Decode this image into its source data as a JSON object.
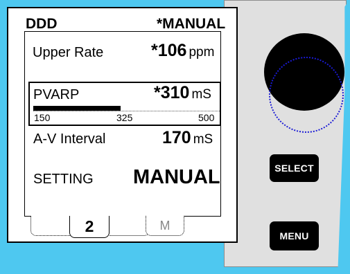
{
  "header": {
    "mode": "DDD",
    "status": "*MANUAL"
  },
  "upper_rate": {
    "label": "Upper Rate",
    "value": "*106",
    "unit": "ppm"
  },
  "pvarp": {
    "label": "PVARP",
    "value": "*310",
    "unit": "mS",
    "scale": {
      "min_label": "150",
      "mid_label": "325",
      "max_label": "500"
    },
    "slider_fraction": 0.47
  },
  "av_interval": {
    "label": "A-V Interval",
    "value": "170",
    "unit": "mS"
  },
  "setting": {
    "label": "SETTING",
    "value": "MANUAL"
  },
  "tabs": {
    "active": "2",
    "m_label": "M"
  },
  "buttons": {
    "select": "SELECT",
    "menu": "MENU"
  },
  "colors": {
    "background": "#4ec8f0",
    "knob_ring": "#1a1ad6"
  }
}
